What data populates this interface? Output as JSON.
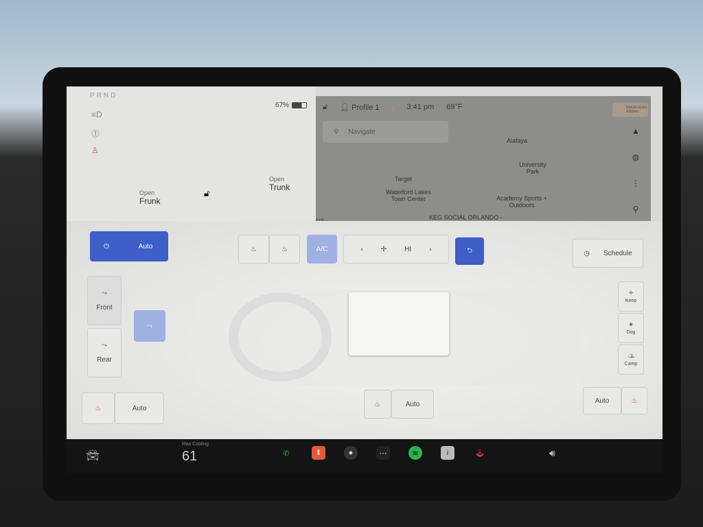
{
  "status": {
    "gear": "PRND",
    "battery": "67%",
    "battery_level": 67,
    "profile": "Profile 1",
    "time": "3:41 pm",
    "temp": "69°F"
  },
  "car": {
    "frunk_open": "Open",
    "frunk": "Frunk",
    "trunk_open": "Open",
    "trunk": "Trunk"
  },
  "map": {
    "search_placeholder": "Navigate",
    "airbag": "PASSENGER AIRBAG",
    "labels": [
      "Alafaya",
      "University Park",
      "Target",
      "Waterford Lakes Town Center",
      "Academy Sports + Outdoors",
      "KEG SOCIAL ORLANDO - Dining &",
      "col"
    ]
  },
  "climate": {
    "auto": "Auto",
    "ac": "A/C",
    "fan": "HI",
    "schedule": "Schedule",
    "front": "Front",
    "rear": "Rear",
    "seat_auto": "Auto",
    "wheel_auto": "Auto",
    "right_auto": "Auto",
    "modes": [
      "Keep",
      "Dog",
      "Camp"
    ],
    "accent": "#3e5ec8"
  },
  "bar": {
    "temp_label": "Max Cooling",
    "temp_value": "61"
  }
}
